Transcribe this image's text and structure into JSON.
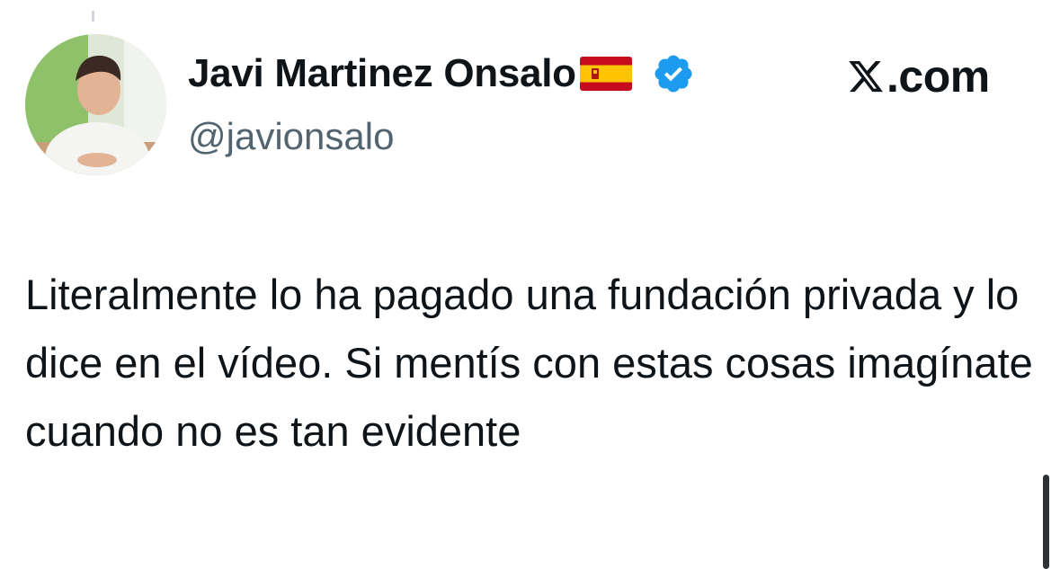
{
  "user": {
    "display_name": "Javi Martinez Onsalo",
    "flag_icon": "spain-flag-icon",
    "verified_icon": "verified-badge-icon",
    "verified_color": "#1d9bf0",
    "handle": "@javionsalo"
  },
  "site": {
    "logo_icon": "x-logo-icon",
    "label": ".com"
  },
  "tweet": {
    "text": "Literalmente lo ha pagado una fundación privada y lo dice en el vídeo. Si mentís con estas cosas imagínate cuando no es tan evidente"
  },
  "colors": {
    "text_primary": "#0f1419",
    "text_secondary": "#536471",
    "accent": "#1d9bf0"
  }
}
